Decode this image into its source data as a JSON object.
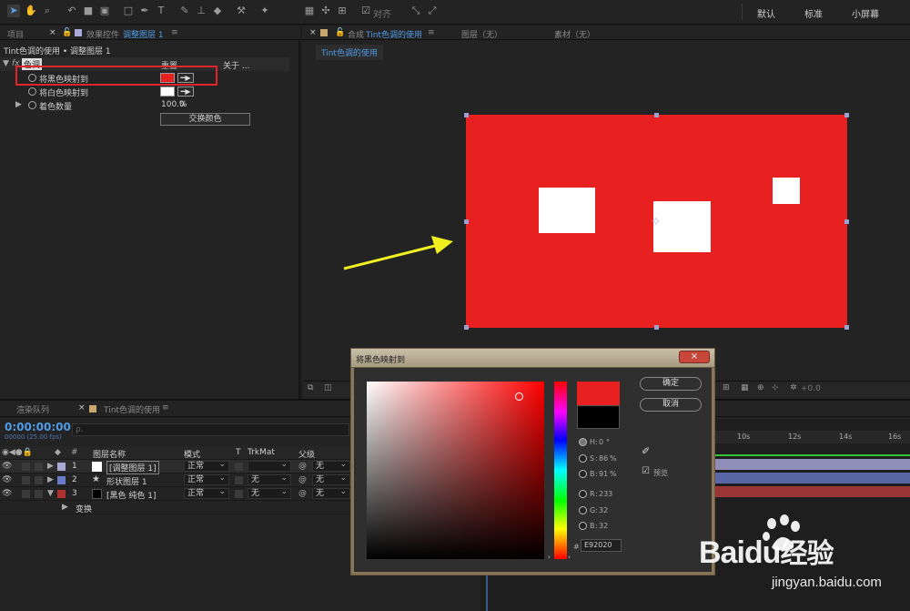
{
  "toolbar": {
    "workspaces": [
      "默认",
      "标准",
      "小屏幕"
    ],
    "snap_label": "对齐"
  },
  "effect_panel": {
    "tabs": [
      {
        "label": "项目"
      },
      {
        "label": "效果控件"
      },
      {
        "label": "调整图层 1"
      }
    ],
    "breadcrumb": "Tint色调的使用 • 调整图层 1",
    "effect_name": "色调",
    "reset_label": "重置",
    "about_label": "关于 ...",
    "properties": [
      {
        "label": "将黑色映射到",
        "color": "#e92020"
      },
      {
        "label": "将白色映射到",
        "color": "#ffffff"
      },
      {
        "label": "着色数量",
        "value": "100.0",
        "unit": "%"
      }
    ],
    "swap_button": "交换颜色"
  },
  "comp_panel": {
    "tabs": [
      {
        "label": "合成"
      },
      {
        "label": "Tint色调的使用"
      },
      {
        "label": "图层（无）"
      },
      {
        "label": "素材（无）"
      }
    ],
    "sub_tab": "Tint色调的使用",
    "composition_bg": "#e92020",
    "footer_value": "+0.0"
  },
  "timeline": {
    "tabs": [
      {
        "label": "渲染队列"
      },
      {
        "label": "Tint色调的使用"
      }
    ],
    "timecode": "0:00:00:00",
    "fps": "00000 (25.00 fps)",
    "search_placeholder": "ρ.",
    "columns": {
      "name": "图层名称",
      "mode": "模式",
      "t": "T",
      "trkmat": "TrkMat",
      "parent": "父级"
    },
    "layers": [
      {
        "num": "1",
        "name": "[调整图层 1]",
        "mode": "正常",
        "trkmat": "",
        "parent": "无",
        "label_color": "#a9a9d6",
        "bar_color": "#8e8eb8"
      },
      {
        "num": "2",
        "name": "形状图层 1",
        "mode": "正常",
        "trkmat": "无",
        "parent": "无",
        "label_color": "#6a7ac8",
        "bar_color": "#5a67a6"
      },
      {
        "num": "3",
        "name": "[黑色 纯色 1]",
        "mode": "正常",
        "trkmat": "无",
        "parent": "无",
        "label_color": "#b03030",
        "bar_color": "#9a3636"
      }
    ],
    "transform_label": "变换",
    "ruler_ticks": [
      "10s",
      "12s",
      "14s",
      "16s"
    ]
  },
  "color_dialog": {
    "title": "将黑色映射到",
    "ok_label": "确定",
    "cancel_label": "取消",
    "new_color": "#e92020",
    "old_color": "#000000",
    "fields": [
      {
        "key": "H",
        "value": "0",
        "unit": "°"
      },
      {
        "key": "S",
        "value": "86",
        "unit": "%"
      },
      {
        "key": "B",
        "value": "91",
        "unit": "%"
      },
      {
        "key": "R",
        "value": "233",
        "unit": ""
      },
      {
        "key": "G",
        "value": "32",
        "unit": ""
      },
      {
        "key": "B",
        "value": "32",
        "unit": ""
      }
    ],
    "hex_prefix": "#",
    "hex_value": "E92020",
    "preview_label": "预览"
  },
  "watermark": {
    "brand": "Baidu",
    "brand_suffix": "经验",
    "url": "jingyan.baidu.com"
  }
}
